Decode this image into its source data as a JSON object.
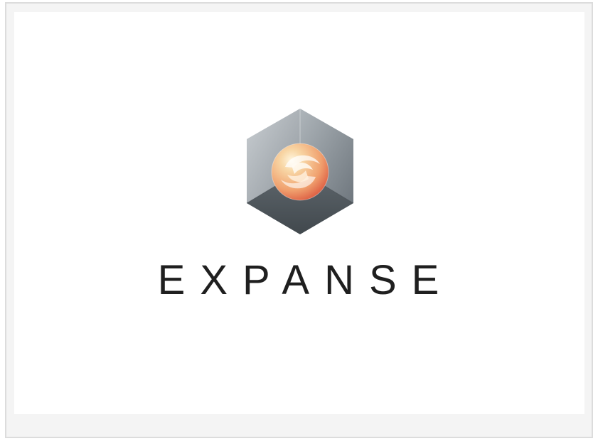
{
  "logo": {
    "wordmark": "EXPANSE",
    "icon": "hexagon-sphere-icon"
  },
  "colors": {
    "frame_background": "#f4f4f4",
    "frame_border": "#dcdcdc",
    "card_background": "#ffffff",
    "wordmark_text": "#1f1f1f",
    "orb_light": "#f8d7a6",
    "orb_dark": "#e76f4f"
  }
}
